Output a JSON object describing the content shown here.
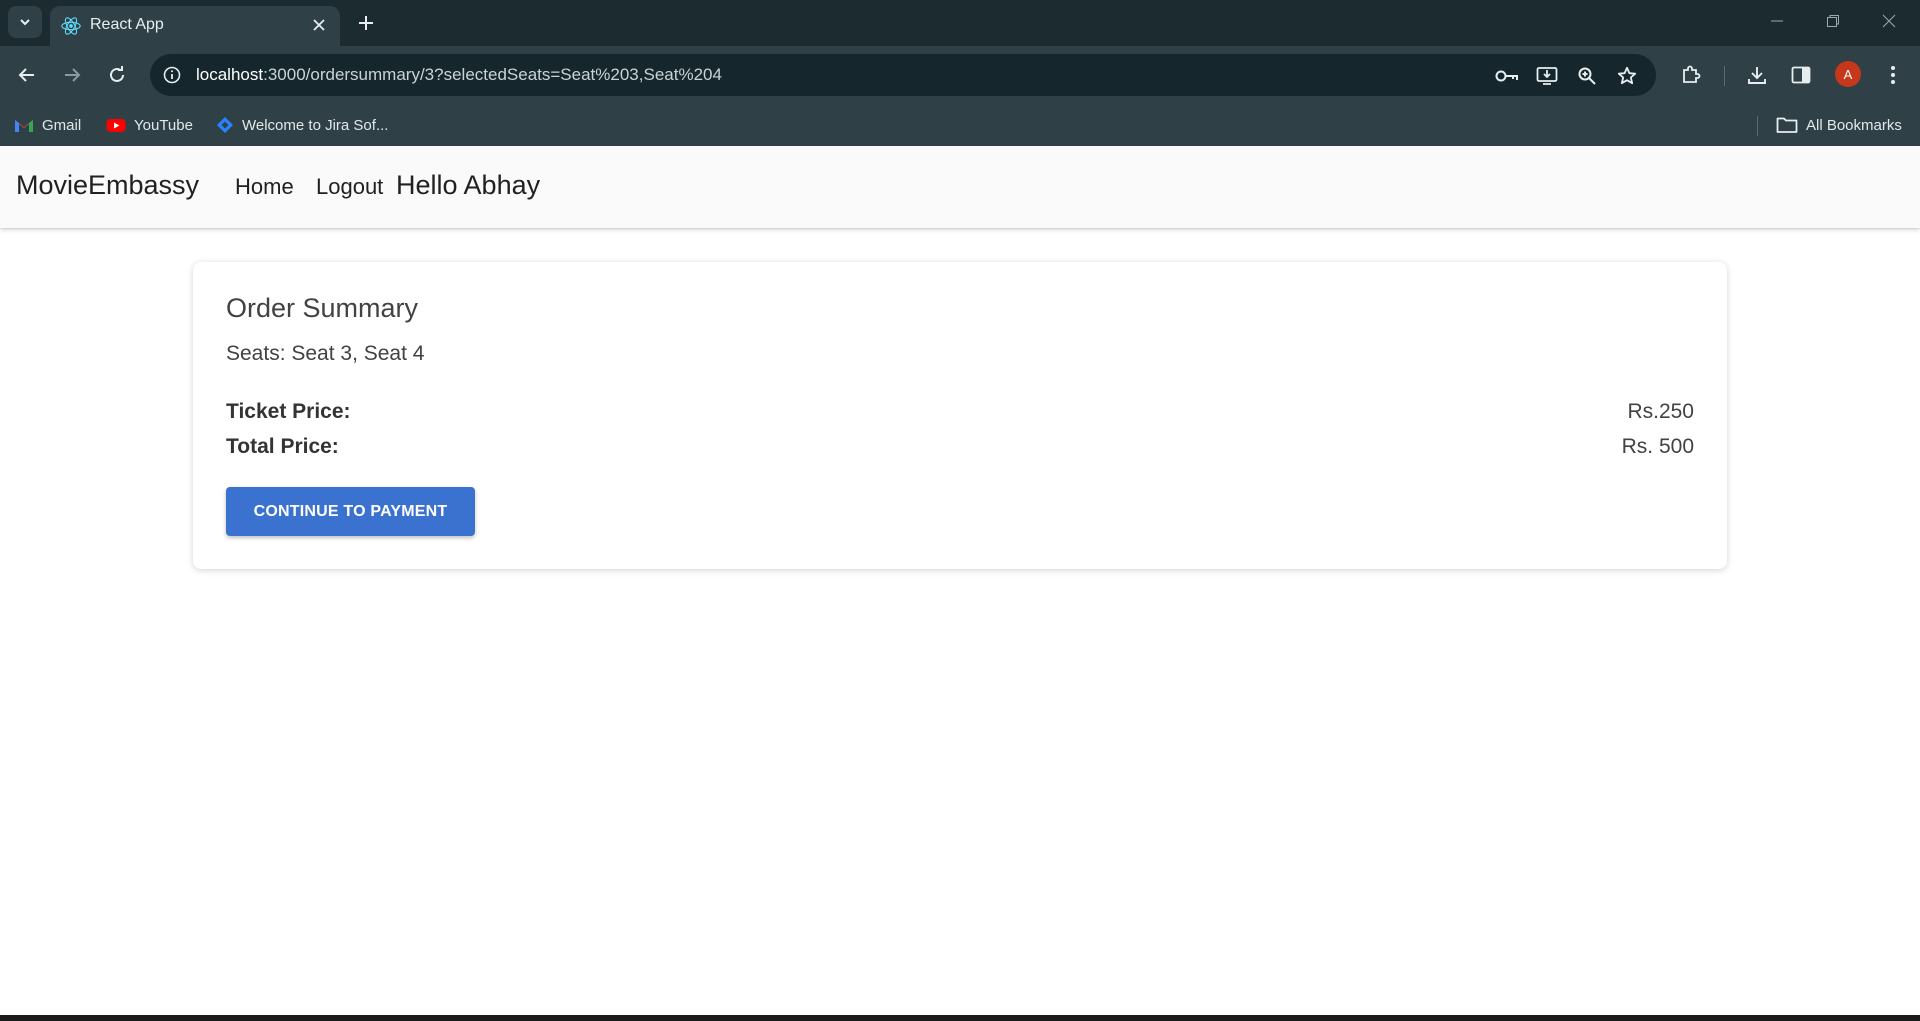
{
  "browser": {
    "tab_title": "React App",
    "url_host": "localhost",
    "url_path": ":3000/ordersummary/3?selectedSeats=Seat%203,Seat%204",
    "avatar_letter": "A",
    "bookmarks": [
      {
        "label": "Gmail",
        "icon": "gmail-icon"
      },
      {
        "label": "YouTube",
        "icon": "youtube-icon"
      },
      {
        "label": "Welcome to Jira Sof...",
        "icon": "jira-icon"
      }
    ],
    "all_bookmarks_label": "All Bookmarks"
  },
  "navbar": {
    "brand": "MovieEmbassy",
    "home_label": "Home",
    "logout_label": "Logout",
    "greeting": "Hello Abhay"
  },
  "order": {
    "title": "Order Summary",
    "seats_text": "Seats: Seat 3, Seat 4",
    "ticket_price_label": "Ticket Price:",
    "ticket_price_value": "Rs.250",
    "total_price_label": "Total Price:",
    "total_price_value": "Rs. 500",
    "continue_button": "CONTINUE TO PAYMENT"
  },
  "colors": {
    "accent": "#3c72cf",
    "chrome_bg": "#2f4147",
    "avatar_bg": "#c5381c"
  }
}
